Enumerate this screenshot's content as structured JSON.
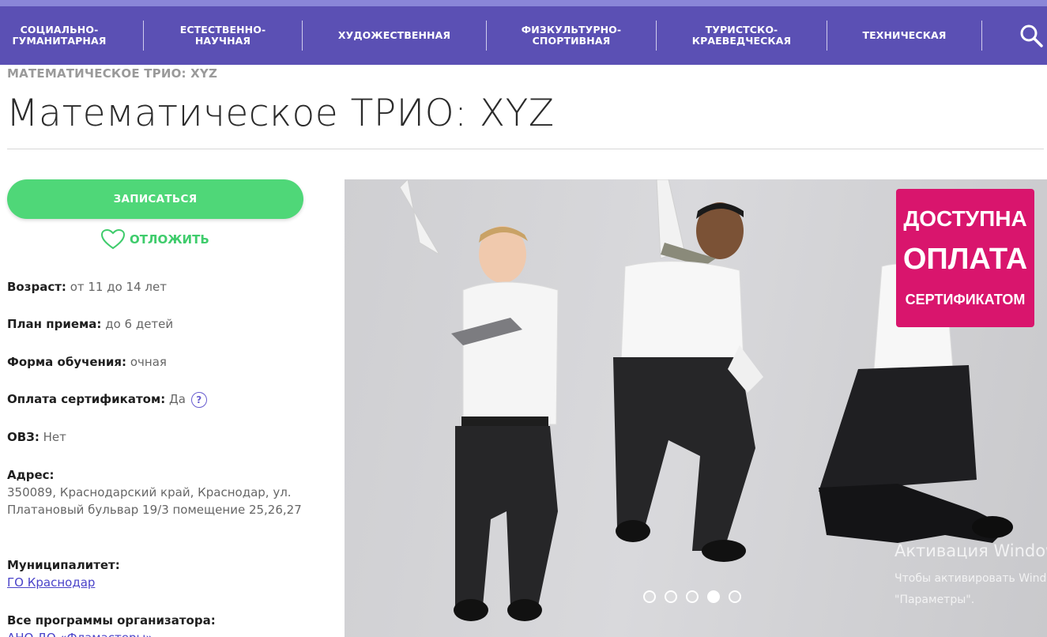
{
  "nav": {
    "items": [
      {
        "label": "СОЦИАЛЬНО-\nГУМАНИТАРНАЯ"
      },
      {
        "label": "ЕСТЕСТВЕННО-\nНАУЧНАЯ"
      },
      {
        "label": "ХУДОЖЕСТВЕННАЯ"
      },
      {
        "label": "ФИЗКУЛЬТУРНО-\nСПОРТИВНАЯ"
      },
      {
        "label": "ТУРИСТСКО-\nКРАЕВЕДЧЕСКАЯ"
      },
      {
        "label": "ТЕХНИЧЕСКАЯ"
      }
    ],
    "search_icon": "search-icon"
  },
  "breadcrumb": "МАТЕМАТИЧЕСКОЕ ТРИО: XYZ",
  "page_title": "Математическое ТРИО: XYZ",
  "actions": {
    "enroll_label": "ЗАПИСАТЬСЯ",
    "postpone_label": "ОТЛОЖИТЬ",
    "postpone_icon": "heart-icon"
  },
  "details": {
    "age_label": "Возраст:",
    "age_value": "от 11 до 14 лет",
    "plan_label": "План приема:",
    "plan_value": "до 6 детей",
    "form_label": "Форма обучения:",
    "form_value": "очная",
    "cert_label": "Оплата сертификатом:",
    "cert_value": "Да",
    "cert_help": "?",
    "ovz_label": "ОВЗ:",
    "ovz_value": "Нет",
    "address_label": "Адрес:",
    "address_value": "350089, Краснодарский край, Краснодар, ул. Платановый бульвар 19/3 помещение 25,26,27",
    "municipality_label": "Муниципалитет:",
    "municipality_value": "ГО Краснодар",
    "organizer_label": "Все программы организатора:",
    "organizer_value": "АНО ДО «Фламастеры»"
  },
  "slider": {
    "badge_line1": "ДОСТУПНА",
    "badge_line2": "ОПЛАТА",
    "badge_line3": "СЕРТИФИКАТОМ",
    "dot_count": 5,
    "active_dot": 4
  },
  "watermark": {
    "line1": "Активация Windows",
    "line2": "Чтобы активировать Windows, перейдите в раздел",
    "line3": "\"Параметры\"."
  },
  "colors": {
    "nav_bg": "#5b50b4",
    "enroll_bg": "#4fd778",
    "badge_bg": "#d9156d",
    "link": "#4a43c9"
  }
}
